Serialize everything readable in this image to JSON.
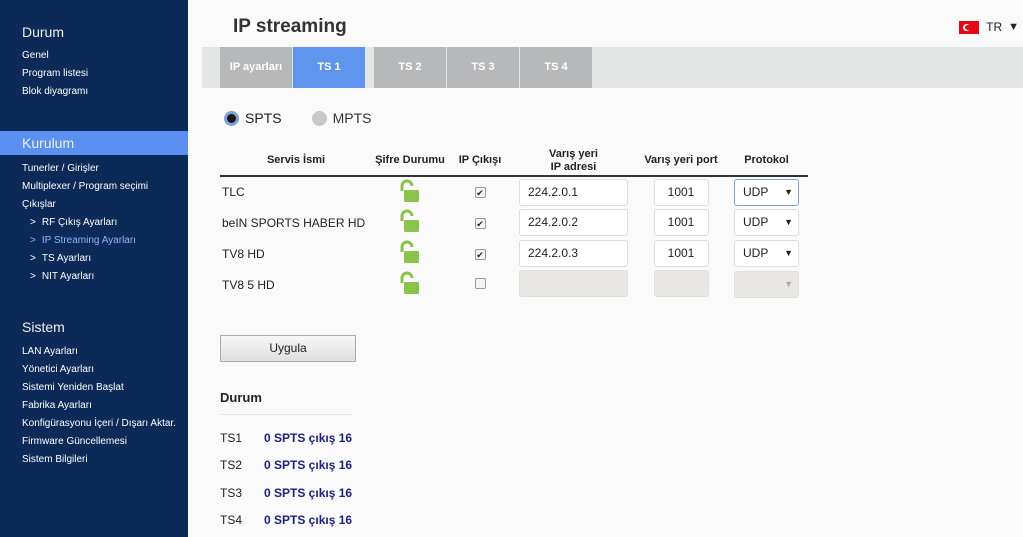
{
  "sidebar": {
    "sections": [
      {
        "title": "Durum",
        "items": [
          {
            "label": "Genel"
          },
          {
            "label": "Program listesi"
          },
          {
            "label": "Blok diyagramı"
          }
        ]
      },
      {
        "title": "Kurulum",
        "items": [
          {
            "label": "Tunerler / Girişler"
          },
          {
            "label": "Multiplexer / Program seçimi"
          },
          {
            "label": "Çıkışlar"
          },
          {
            "label": "RF Çıkış Ayarları",
            "arrow": ">"
          },
          {
            "label": "IP Streaming Ayarları",
            "arrow": ">"
          },
          {
            "label": "TS Ayarları",
            "arrow": ">"
          },
          {
            "label": "NIT Ayarları",
            "arrow": ">"
          }
        ]
      },
      {
        "title": "Sistem",
        "items": [
          {
            "label": "LAN Ayarları"
          },
          {
            "label": "Yönetici Ayarları"
          },
          {
            "label": "Sistemi Yeniden Başlat"
          },
          {
            "label": "Fabrika Ayarları"
          },
          {
            "label": "Konfigürasyonu İçeri / Dışarı Aktar."
          },
          {
            "label": "Firmware Güncellemesi"
          },
          {
            "label": "Sistem Bilgileri"
          }
        ]
      }
    ]
  },
  "header": {
    "title": "IP streaming",
    "language": "TR",
    "language_caret": "▼"
  },
  "tabs": [
    {
      "label": "IP ayarları"
    },
    {
      "label": "TS 1"
    },
    {
      "label": "TS 2"
    },
    {
      "label": "TS 3"
    },
    {
      "label": "TS 4"
    }
  ],
  "mode": {
    "options": [
      {
        "label": "SPTS",
        "selected": true
      },
      {
        "label": "MPTS",
        "selected": false
      }
    ]
  },
  "table": {
    "headers": {
      "name": "Servis İsmi",
      "lock": "Şifre Durumu",
      "ip_out": "IP Çıkışı",
      "dst_ip_1": "Varış yeri",
      "dst_ip_2": "IP adresi",
      "dst_port": "Varış yeri port",
      "protocol": "Protokol"
    },
    "rows": [
      {
        "name": "TLC",
        "lock": "unlocked",
        "ip_output": true,
        "dst_ip": "224.2.0.1",
        "port": "1001",
        "protocol": "UDP",
        "check": "✔"
      },
      {
        "name": "beIN SPORTS HABER HD",
        "lock": "unlocked",
        "ip_output": true,
        "dst_ip": "224.2.0.2",
        "port": "1001",
        "protocol": "UDP",
        "check": "✔"
      },
      {
        "name": "TV8 HD",
        "lock": "unlocked",
        "ip_output": true,
        "dst_ip": "224.2.0.3",
        "port": "1001",
        "protocol": "UDP",
        "check": "✔"
      },
      {
        "name": "TV8 5 HD",
        "lock": "unlocked",
        "ip_output": false,
        "dst_ip": "",
        "port": "",
        "protocol": "",
        "check": ""
      }
    ],
    "dropdown_caret": "▼"
  },
  "apply_label": "Uygula",
  "status": {
    "title": "Durum",
    "rows": [
      {
        "label": "TS1",
        "value": "0 SPTS çıkış 16"
      },
      {
        "label": "TS2",
        "value": "0 SPTS çıkış 16"
      },
      {
        "label": "TS3",
        "value": "0 SPTS çıkış 16"
      },
      {
        "label": "TS4",
        "value": "0 SPTS çıkış 16"
      }
    ]
  },
  "colors": {
    "sidebar_bg": "#0b2a58",
    "active_accent": "#5f94ef",
    "lock_green": "#8bc34a",
    "status_value": "#1a237e"
  }
}
